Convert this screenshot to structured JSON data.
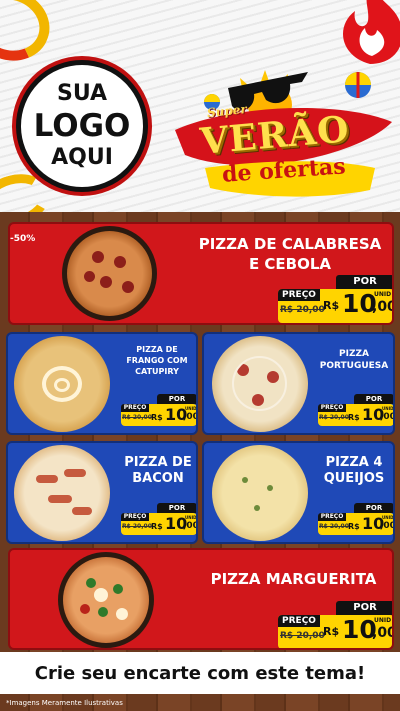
{
  "logo": {
    "line1": "SUA",
    "line2": "LOGO",
    "line3": "AQUI"
  },
  "promo": {
    "super": "Super",
    "verao": "VERÃO",
    "ofertas": "de ofertas"
  },
  "badge": "-50%",
  "products": [
    {
      "name_line1": "PIZZA DE CALABRESA",
      "name_line2": "E CEBOLA",
      "por": "POR",
      "preco": "PREÇO",
      "old": "R$ 20,00",
      "currency": "R$",
      "int": "10",
      "cents": ",00",
      "unid": "UNID"
    },
    {
      "name_line1": "PIZZA DE",
      "name_line2": "FRANGO COM",
      "name_line3": "CATUPIRY",
      "por": "POR",
      "preco": "PREÇO",
      "old": "R$ 20,00",
      "currency": "R$",
      "int": "10",
      "cents": ",00",
      "unid": "UNID"
    },
    {
      "name_line1": "PIZZA",
      "name_line2": "PORTUGUESA",
      "por": "POR",
      "preco": "PREÇO",
      "old": "R$ 20,00",
      "currency": "R$",
      "int": "10",
      "cents": ",00",
      "unid": "UNID"
    },
    {
      "name_line1": "PIZZA DE",
      "name_line2": "BACON",
      "por": "POR",
      "preco": "PREÇO",
      "old": "R$ 20,00",
      "currency": "R$",
      "int": "10",
      "cents": ",00",
      "unid": "UNID"
    },
    {
      "name_line1": "PIZZA 4",
      "name_line2": "QUEIJOS",
      "por": "POR",
      "preco": "PREÇO",
      "old": "R$ 20,00",
      "currency": "R$",
      "int": "10",
      "cents": ",00",
      "unid": "UNID"
    },
    {
      "name_line1": "PIZZA MARGUERITA",
      "por": "POR",
      "preco": "PREÇO",
      "old": "R$ 20,00",
      "currency": "R$",
      "int": "10",
      "cents": ",00",
      "unid": "UNID"
    }
  ],
  "cta": "Crie seu encarte com este tema!",
  "footnote": "*Imagens Meramente Ilustrativas",
  "colors": {
    "red": "#d1171b",
    "blue": "#1f49b7",
    "yellow": "#ffd400",
    "black": "#111111"
  }
}
